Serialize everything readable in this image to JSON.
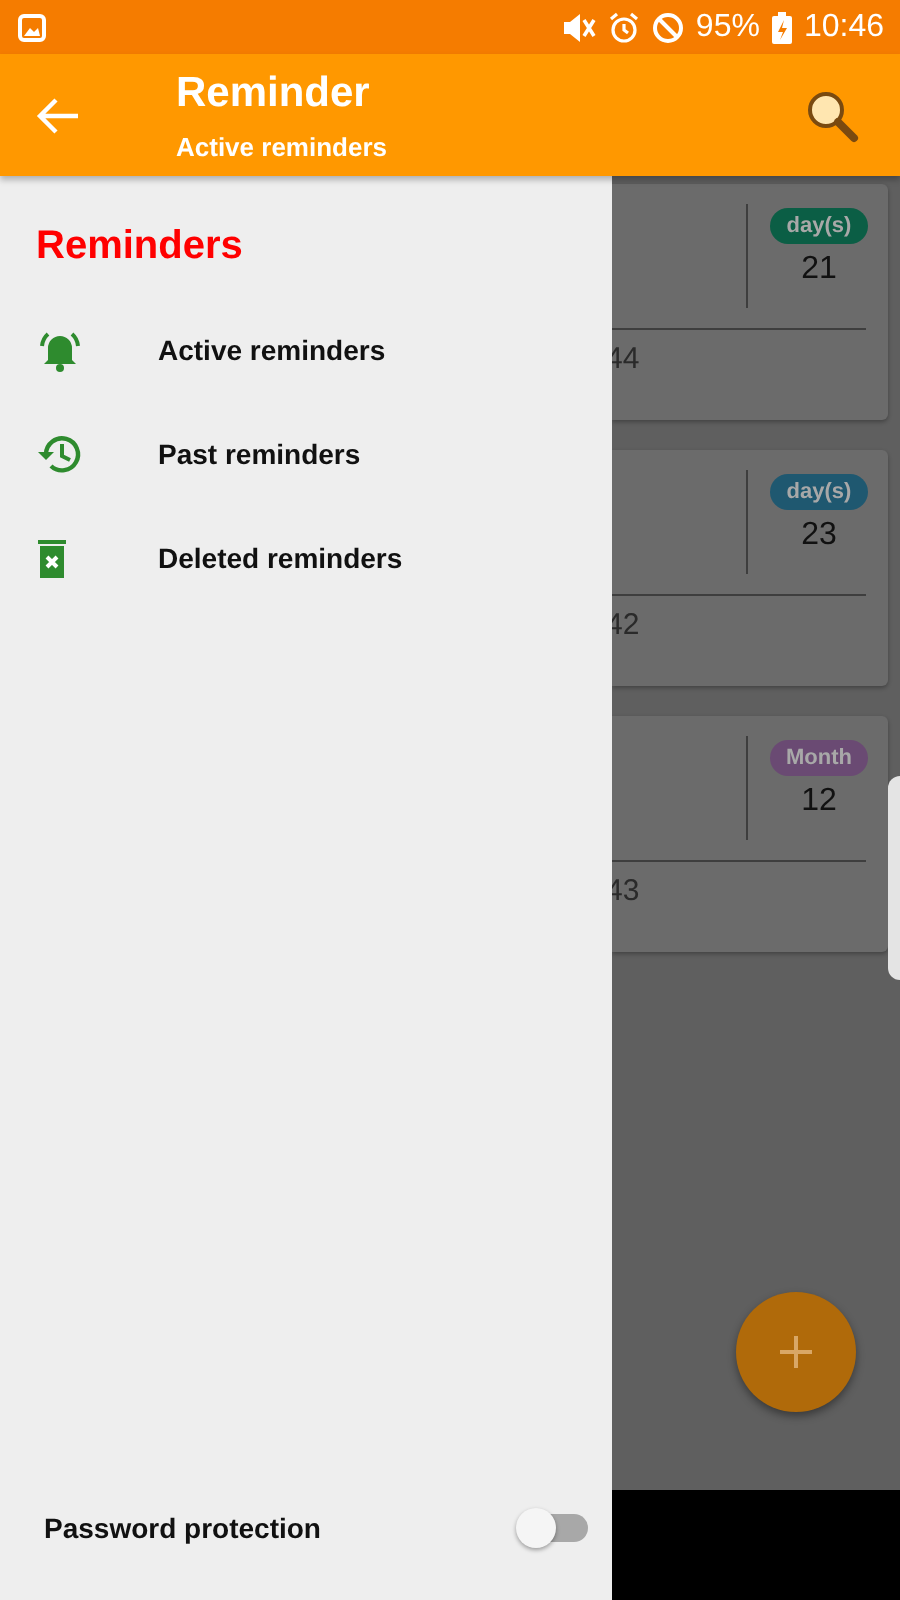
{
  "status_bar": {
    "battery": "95%",
    "time": "10:46"
  },
  "app_bar": {
    "title": "Reminder",
    "subtitle": "Active reminders"
  },
  "drawer": {
    "heading": "Reminders",
    "items": [
      {
        "label": "Active reminders"
      },
      {
        "label": "Past reminders"
      },
      {
        "label": "Deleted reminders"
      }
    ],
    "password_protection": {
      "label": "Password protection",
      "on": false
    }
  },
  "cards": [
    {
      "unit": "day(s)",
      "color": "#0b5e45",
      "count": "21",
      "time": "44"
    },
    {
      "unit": "day(s)",
      "color": "#1f5870",
      "count": "23",
      "time": "42"
    },
    {
      "unit": "Month",
      "color": "#6a4a73",
      "count": "12",
      "time": "43"
    }
  ]
}
